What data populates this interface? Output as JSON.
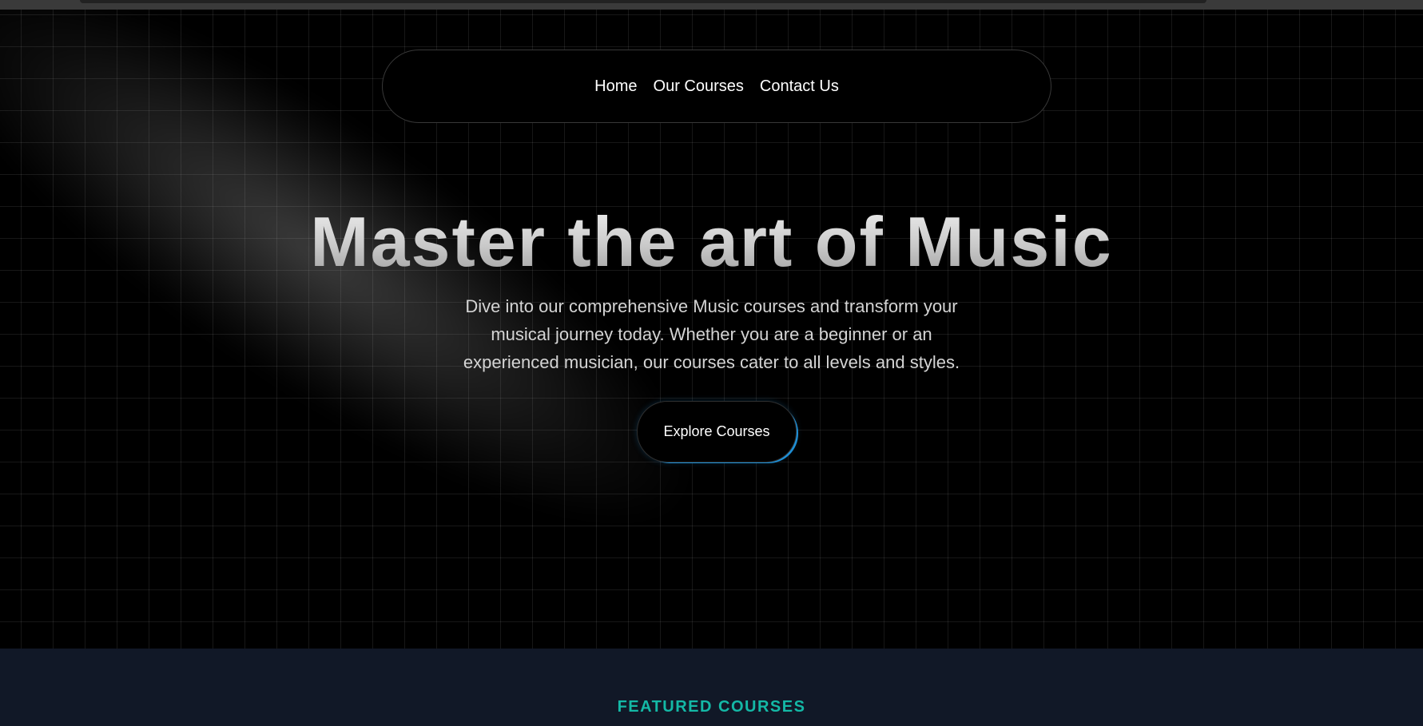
{
  "nav": {
    "links": [
      "Home",
      "Our Courses",
      "Contact Us"
    ]
  },
  "hero": {
    "title": "Master the art of Music",
    "description": "Dive into our comprehensive Music courses and transform your musical journey today. Whether you are a beginner or an experienced musician, our courses cater to all levels and styles.",
    "cta_label": "Explore Courses"
  },
  "featured": {
    "heading": "FEATURED COURSES"
  },
  "colors": {
    "background": "#000000",
    "section_bg": "#111827",
    "accent_teal": "#14b8a6",
    "button_glow": "#1e8fd6"
  }
}
